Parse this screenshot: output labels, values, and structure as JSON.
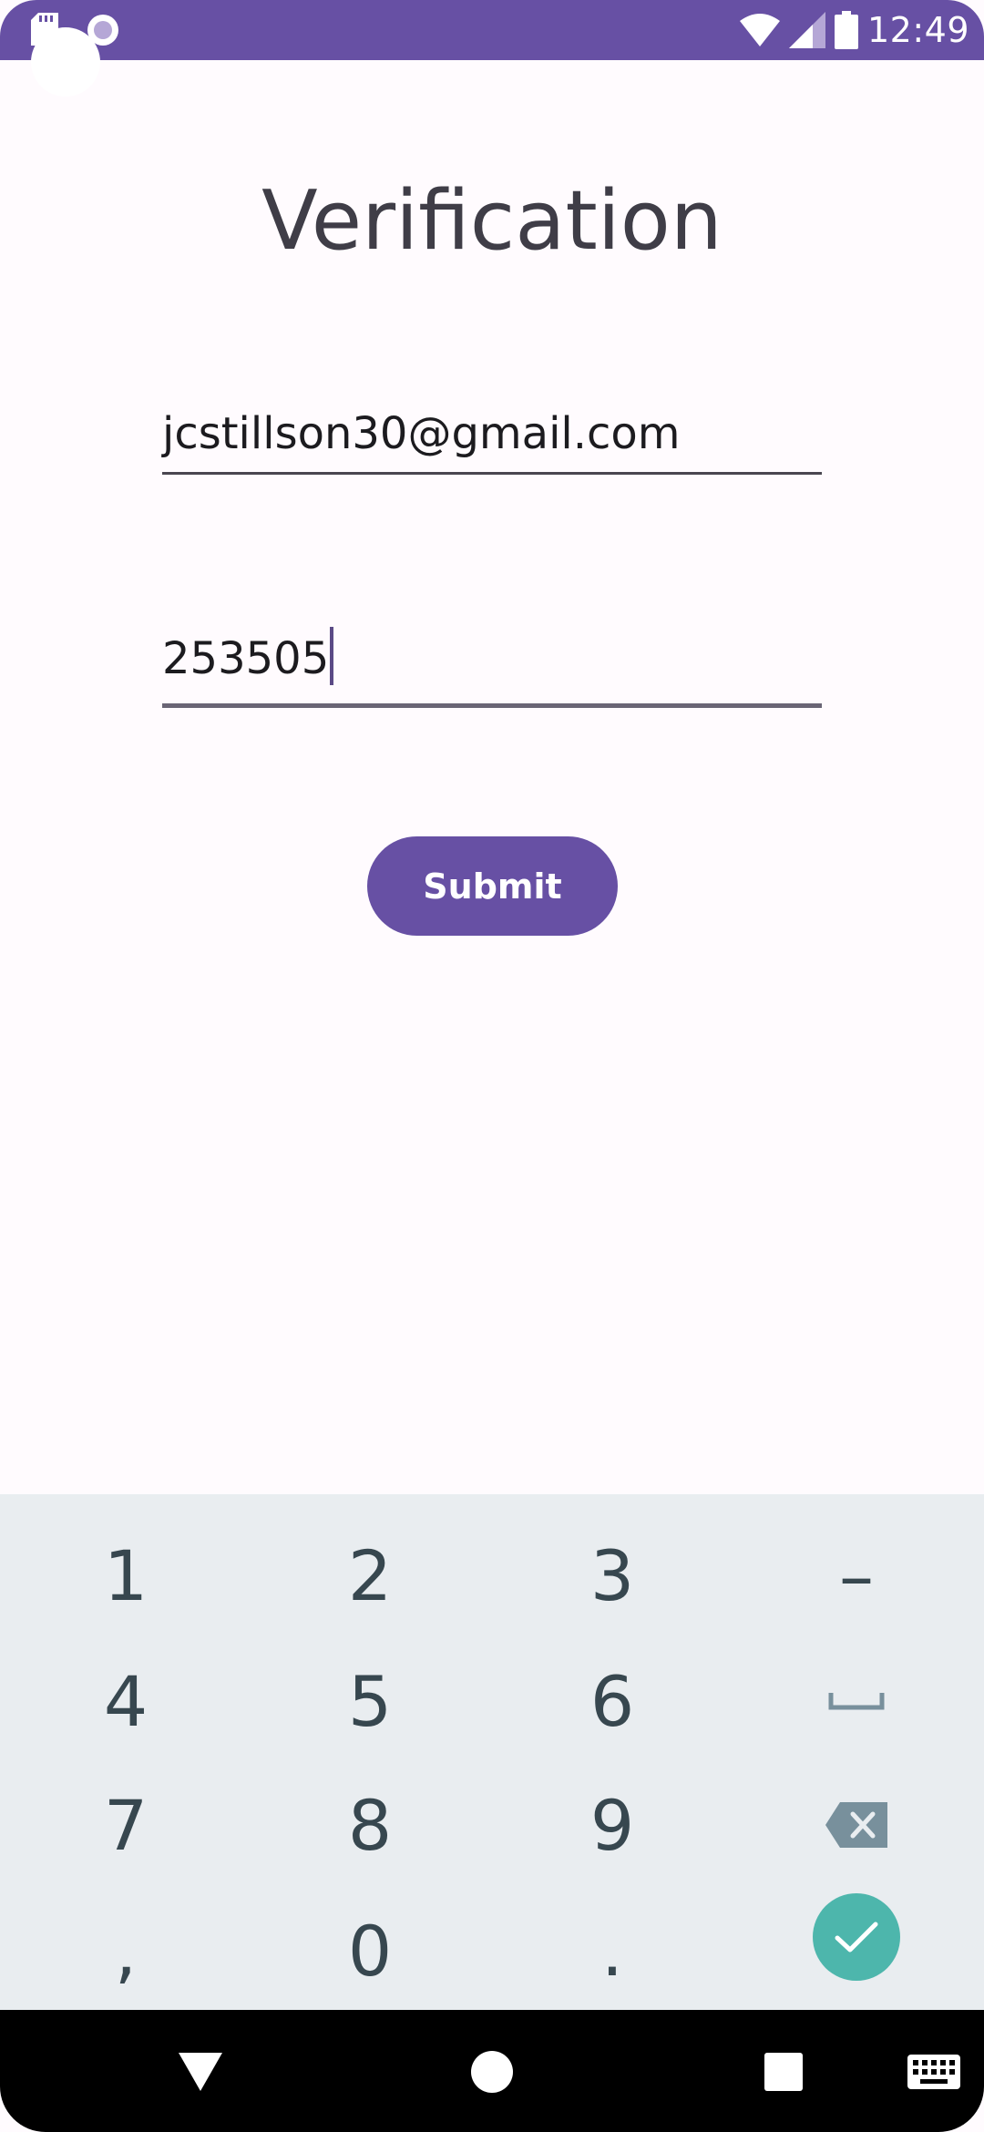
{
  "status_bar": {
    "time": "12:49",
    "icons": [
      "sd-card-icon",
      "radio-button-icon",
      "wifi-icon",
      "signal-icon",
      "battery-icon"
    ]
  },
  "main": {
    "title": "Verification",
    "email_value": "jcstillson30@gmail.com",
    "code_value": "253505",
    "submit_label": "Submit"
  },
  "keyboard": {
    "rows": [
      [
        "1",
        "2",
        "3",
        "–"
      ],
      [
        "4",
        "5",
        "6",
        "space-icon"
      ],
      [
        "7",
        "8",
        "9",
        "backspace-icon"
      ],
      [
        ",",
        "0",
        ".",
        "done-icon"
      ]
    ],
    "k1": "1",
    "k2": "2",
    "k3": "3",
    "kdash": "–",
    "k4": "4",
    "k5": "5",
    "k6": "6",
    "k7": "7",
    "k8": "8",
    "k9": "9",
    "kcomma": ",",
    "k0": "0",
    "kdot": "."
  },
  "nav_bar": {
    "icons": [
      "back-icon",
      "home-icon",
      "recents-icon",
      "keyboard-switch-icon"
    ]
  },
  "colors": {
    "accent": "#6750a4",
    "keyboard_bg": "#e9edf0",
    "done_key": "#4db6ac",
    "background": "#fffbfe"
  }
}
